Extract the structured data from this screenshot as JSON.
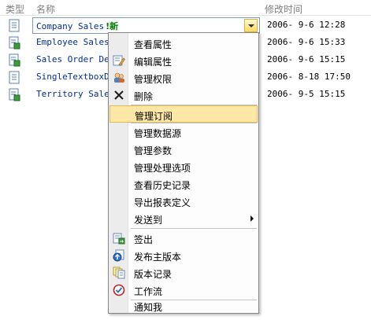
{
  "columns": {
    "type": "类型",
    "name": "名称",
    "modified": "修改时间"
  },
  "rows": [
    {
      "name": "Company Sales",
      "badge": "新",
      "time": "2006- 9-6 12:28"
    },
    {
      "name": "Employee Sales",
      "time": "2006- 9-6 15:33"
    },
    {
      "name": "Sales Order Det",
      "time": "2006- 9-6 15:15"
    },
    {
      "name": "SingleTextboxDr",
      "time": "2006- 8-18 17:50"
    },
    {
      "name": "Territory Sales",
      "time": "2006- 9-5 15:15"
    }
  ],
  "menu": {
    "items": [
      {
        "label": "查看属性",
        "icon": "none"
      },
      {
        "label": "编辑属性",
        "icon": "edit-properties-icon"
      },
      {
        "label": "管理权限",
        "icon": "permissions-icon"
      },
      {
        "label": "删除",
        "icon": "delete-x-icon"
      },
      {
        "label": "管理订阅",
        "icon": "none",
        "highlighted": true
      },
      {
        "label": "管理数据源",
        "icon": "none"
      },
      {
        "label": "管理参数",
        "icon": "none"
      },
      {
        "label": "管理处理选项",
        "icon": "none"
      },
      {
        "label": "查看历史记录",
        "icon": "none"
      },
      {
        "label": "导出报表定义",
        "icon": "none"
      },
      {
        "label": "发送到",
        "icon": "none",
        "submenu": true
      },
      {
        "label": "签出",
        "icon": "check-out-icon"
      },
      {
        "label": "发布主版本",
        "icon": "publish-icon"
      },
      {
        "label": "版本记录",
        "icon": "version-history-icon"
      },
      {
        "label": "工作流",
        "icon": "workflow-icon"
      },
      {
        "label": "通知我",
        "icon": "none"
      }
    ]
  },
  "colors": {
    "link": "#002c99",
    "highlight": "#ffe8a6",
    "new_badge": "#008000"
  }
}
